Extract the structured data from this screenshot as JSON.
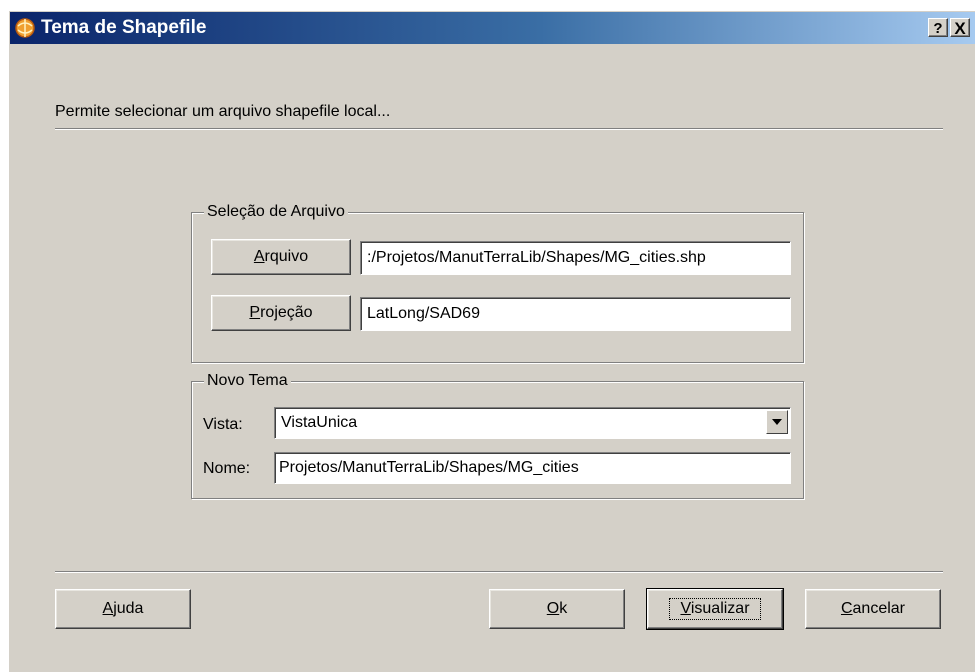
{
  "window": {
    "title": "Tema de Shapefile",
    "help_label": "?",
    "close_label": "X"
  },
  "description": "Permite selecionar um arquivo shapefile local...",
  "file_group": {
    "legend": "Seleção de Arquivo",
    "arquivo_button": {
      "mnemonic": "A",
      "rest": "rquivo"
    },
    "arquivo_value": ":/Projetos/ManutTerraLib/Shapes/MG_cities.shp",
    "projecao_button": {
      "mnemonic": "P",
      "rest": "rojeção"
    },
    "projecao_value": "LatLong/SAD69"
  },
  "theme_group": {
    "legend": "Novo Tema",
    "vista_label": "Vista:",
    "vista_value": "VistaUnica",
    "nome_label": "Nome:",
    "nome_value": "Projetos/ManutTerraLib/Shapes/MG_cities"
  },
  "buttons": {
    "ajuda": {
      "mnemonic": "A",
      "rest": "juda"
    },
    "ok": {
      "mnemonic": "O",
      "rest": "k"
    },
    "visualizar": {
      "mnemonic": "V",
      "rest": "isualizar"
    },
    "cancelar": {
      "mnemonic": "C",
      "rest": "ancelar"
    }
  },
  "icons": {
    "app": "shapefile-app-icon",
    "dropdown": "chevron-down-icon"
  }
}
